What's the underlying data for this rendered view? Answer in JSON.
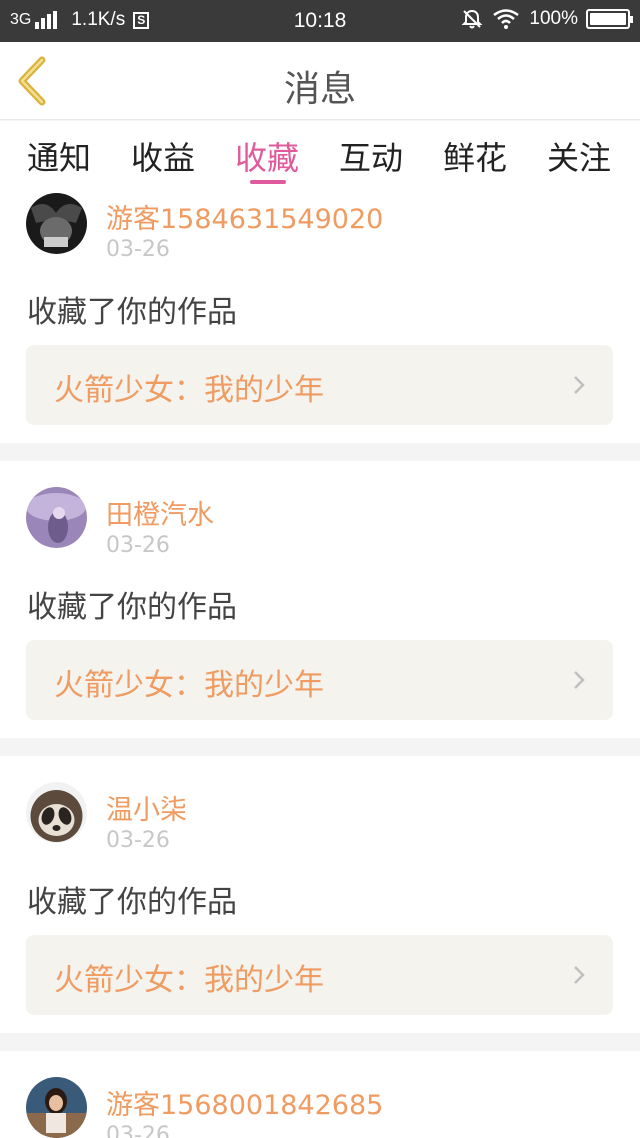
{
  "status_bar": {
    "network": "3G",
    "speed": "1.1K/s",
    "app_badge": "S",
    "time": "10:18",
    "battery": "100%"
  },
  "nav": {
    "title": "消息"
  },
  "tabs": [
    {
      "label": "通知"
    },
    {
      "label": "收益"
    },
    {
      "label": "收藏"
    },
    {
      "label": "互动"
    },
    {
      "label": "鲜花"
    },
    {
      "label": "关注"
    }
  ],
  "active_tab": "收藏",
  "messages": [
    {
      "username": "游客1584631549020",
      "date": "03-26",
      "action": "收藏了你的作品",
      "work_title": "火箭少女：我的少年"
    },
    {
      "username": "田橙汽水",
      "date": "03-26",
      "action": "收藏了你的作品",
      "work_title": "火箭少女：我的少年"
    },
    {
      "username": "温小柒",
      "date": "03-26",
      "action": "收藏了你的作品",
      "work_title": "火箭少女：我的少年"
    },
    {
      "username": "游客1568001842685",
      "date": "03-26"
    }
  ],
  "colors": {
    "accent": "#e05a9c",
    "username": "#ef9b61",
    "back_arrow": "#d9b23f",
    "status_bar": "#3a3a3a"
  }
}
